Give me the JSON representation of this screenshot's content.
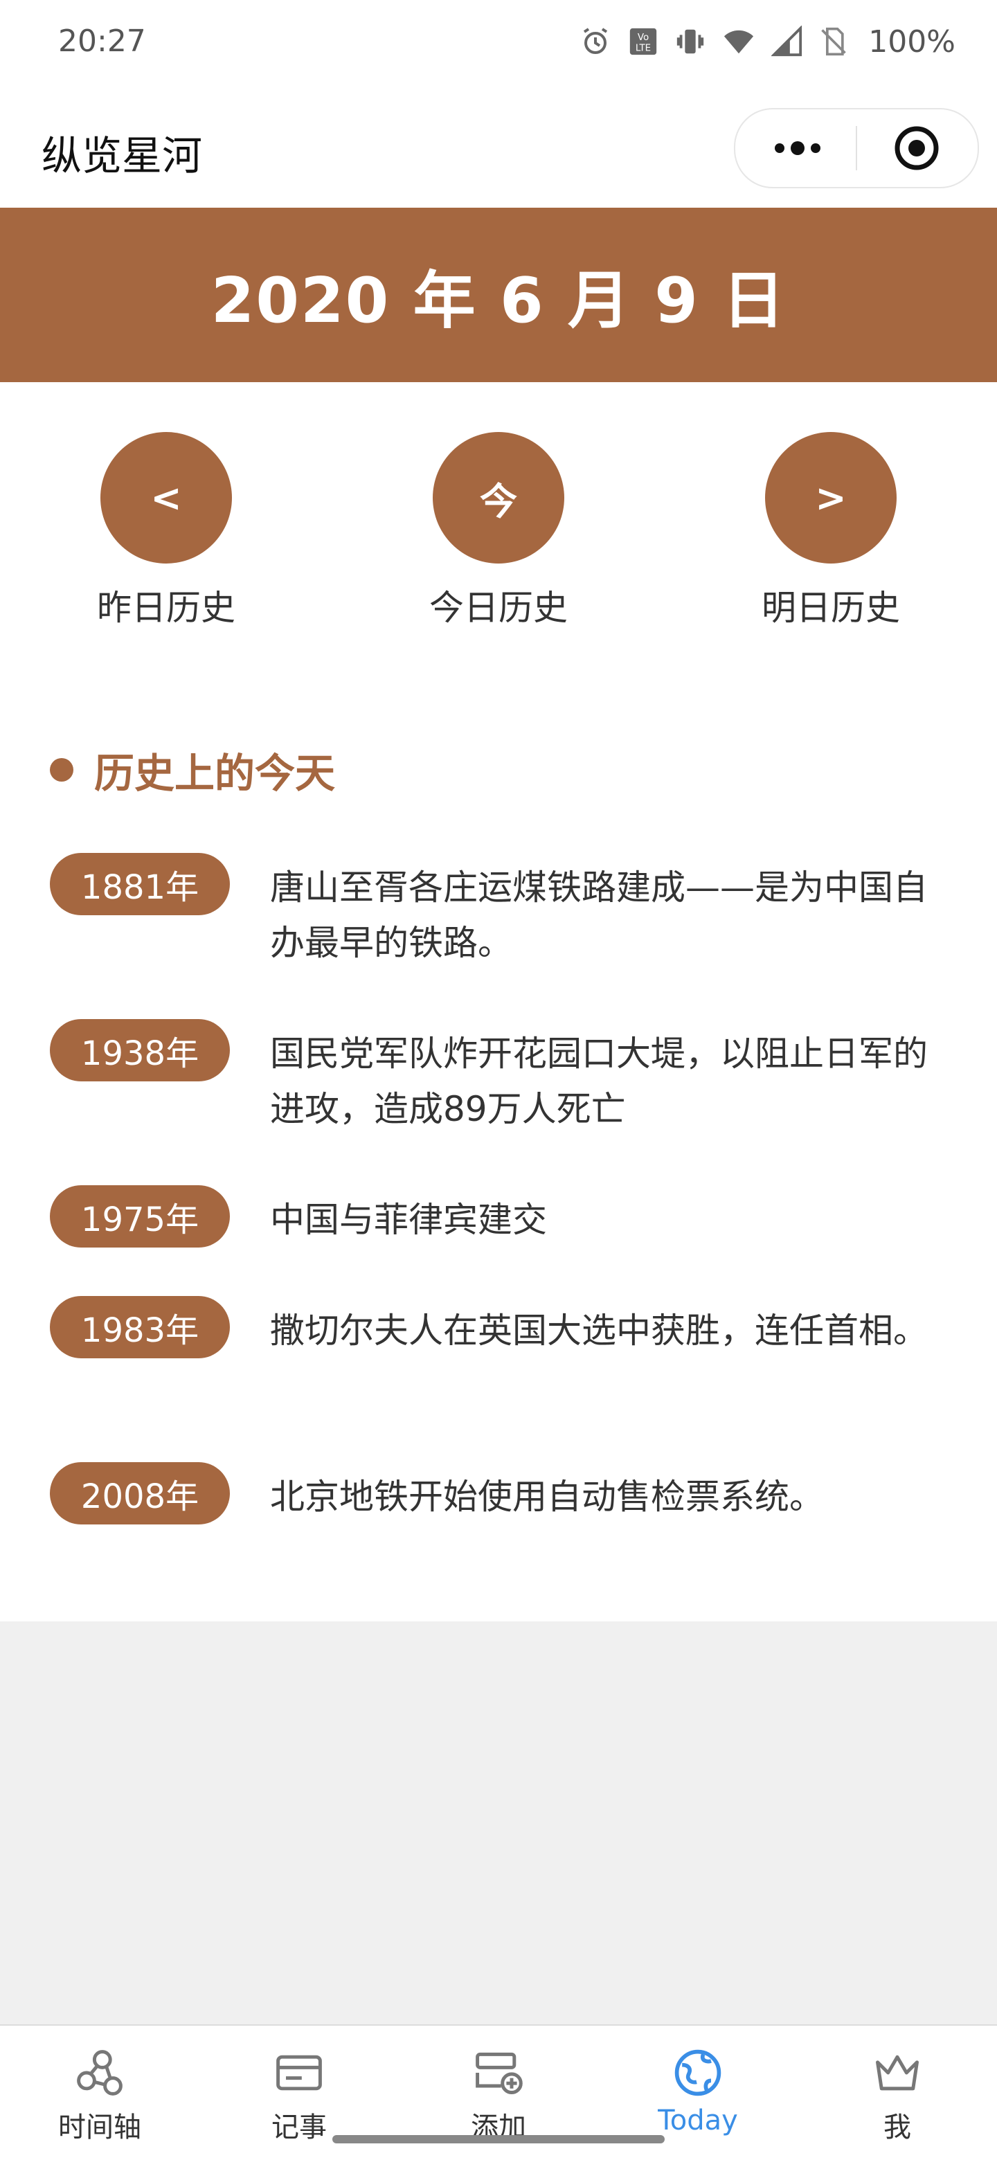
{
  "status_bar": {
    "time": "20:27",
    "battery": "100%",
    "icons": [
      "alarm-icon",
      "volte-icon",
      "vibrate-icon",
      "wifi-icon",
      "signal-icon",
      "no-sim-icon"
    ]
  },
  "nav": {
    "title": "纵览星河",
    "more_icon": "more-dots-icon",
    "close_icon": "target-circle-icon"
  },
  "date_banner": "2020 年 6 月 9 日",
  "day_nav": [
    {
      "symbol": "<",
      "label": "昨日历史"
    },
    {
      "symbol": "今",
      "label": "今日历史"
    },
    {
      "symbol": ">",
      "label": "明日历史"
    }
  ],
  "section": {
    "title": "历史上的今天"
  },
  "events": [
    {
      "year": "1881年",
      "text": "唐山至胥各庄运煤铁路建成——是为中国自办最早的铁路。"
    },
    {
      "year": "1938年",
      "text": "国民党军队炸开花园口大堤，以阻止日军的进攻，造成89万人死亡"
    },
    {
      "year": "1975年",
      "text": "中国与菲律宾建交"
    },
    {
      "year": "1983年",
      "text": "撒切尔夫人在英国大选中获胜，连任首相。"
    },
    {
      "year": "2008年",
      "text": "北京地铁开始使用自动售检票系统。"
    }
  ],
  "tabbar": [
    {
      "label": "时间轴",
      "icon": "timeline-icon",
      "active": false
    },
    {
      "label": "记事",
      "icon": "notes-card-icon",
      "active": false
    },
    {
      "label": "添加",
      "icon": "add-record-icon",
      "active": false
    },
    {
      "label": "Today",
      "icon": "globe-icon",
      "active": true
    },
    {
      "label": "我",
      "icon": "crown-icon",
      "active": false
    }
  ],
  "colors": {
    "accent": "#a56740",
    "active_tab": "#3a8ee6",
    "background": "#f0f0f0"
  }
}
